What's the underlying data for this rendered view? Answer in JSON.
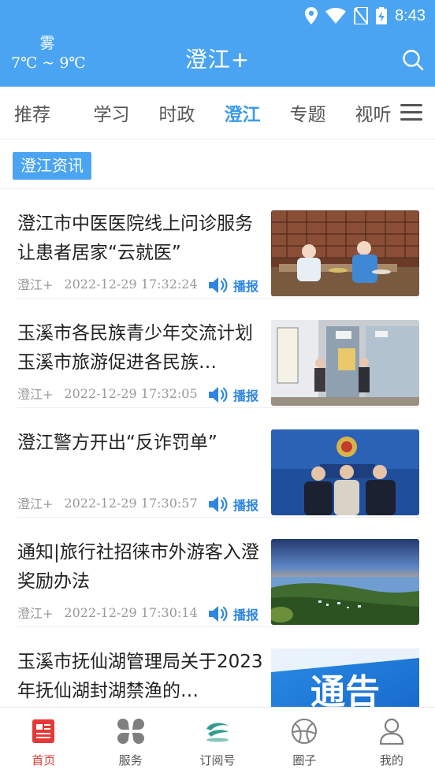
{
  "status_bar": {
    "time": "8:43"
  },
  "header": {
    "weather_condition": "雾",
    "weather_temp": "7℃ ~ 9℃",
    "title": "澄江+"
  },
  "tabs": [
    {
      "label": "推荐",
      "active": false
    },
    {
      "label": "学习",
      "active": false
    },
    {
      "label": "时政",
      "active": false
    },
    {
      "label": "澄江",
      "active": true
    },
    {
      "label": "专题",
      "active": false
    },
    {
      "label": "视听",
      "active": false
    }
  ],
  "section": {
    "label": "澄江资讯"
  },
  "news": [
    {
      "title": "澄江市中医医院线上问诊服务让患者居家“云就医”",
      "source": "澄江+",
      "time": "2022-12-29 17:32:24",
      "play_label": "播报",
      "thumb": "pharmacy"
    },
    {
      "title": "玉溪市各民族青少年交流计划 玉溪市旅游促进各民族…",
      "source": "澄江+",
      "time": "2022-12-29 17:32:05",
      "play_label": "播报",
      "thumb": "museum"
    },
    {
      "title": "澄江警方开出“反诈罚单”",
      "source": "澄江+",
      "time": "2022-12-29 17:30:57",
      "play_label": "播报",
      "thumb": "police"
    },
    {
      "title": "通知|旅行社招徕市外游客入澄奖励办法",
      "source": "澄江+",
      "time": "2022-12-29 17:30:14",
      "play_label": "播报",
      "thumb": "lake"
    },
    {
      "title": "玉溪市抚仙湖管理局关于2023年抚仙湖封湖禁渔的…",
      "source": "",
      "time": "",
      "play_label": "",
      "thumb": "notice",
      "thumb_text": "通告"
    }
  ],
  "bottom_nav": [
    {
      "label": "首页",
      "icon": "home-news-icon",
      "active": true
    },
    {
      "label": "服务",
      "icon": "services-grid-icon",
      "active": false
    },
    {
      "label": "订阅号",
      "icon": "subscription-icon",
      "active": false
    },
    {
      "label": "圈子",
      "icon": "circle-community-icon",
      "active": false
    },
    {
      "label": "我的",
      "icon": "profile-icon",
      "active": false
    }
  ],
  "colors": {
    "brand_blue": "#4ba4f2",
    "active_red": "#e53935",
    "play_blue": "#2f86e0"
  }
}
